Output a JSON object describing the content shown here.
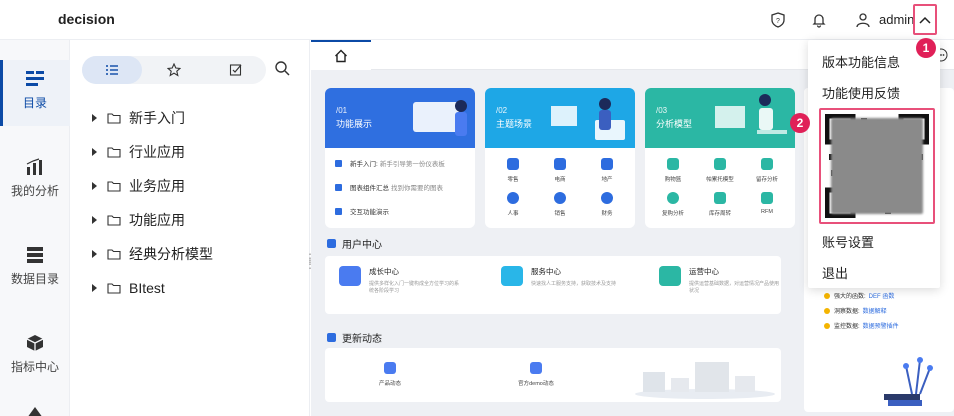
{
  "app": {
    "title": "decision"
  },
  "header": {
    "user": "admin"
  },
  "rail": [
    {
      "label": "目录",
      "active": true
    },
    {
      "label": "我的分析"
    },
    {
      "label": "数据目录"
    },
    {
      "label": "指标中心"
    }
  ],
  "tree": {
    "nodes": [
      "新手入门",
      "行业应用",
      "业务应用",
      "功能应用",
      "经典分析模型",
      "BItest"
    ]
  },
  "banners": [
    {
      "num": "/01",
      "title": "功能展示",
      "color": "#2f6fe0"
    },
    {
      "num": "/02",
      "title": "主题场景",
      "color": "#1ea7e6"
    },
    {
      "num": "/03",
      "title": "分析模型",
      "color": "#2bb7a4"
    }
  ],
  "feature_list": [
    {
      "title": "新手入门:",
      "desc": "新手引导第一份仪表板"
    },
    {
      "title": "图表组件汇总",
      "desc": "找到你需要的图表"
    },
    {
      "title": "交互功能演示",
      "desc": ""
    }
  ],
  "scene_grid": [
    "零售",
    "电商",
    "地产",
    "人事",
    "销售",
    "财务"
  ],
  "model_grid": [
    "购物篮",
    "帕累托模型",
    "留存分析",
    "复购分析",
    "库存周转",
    "RFM"
  ],
  "sections": {
    "user_center": "用户中心",
    "updates": "更新动态"
  },
  "user_center_cards": [
    {
      "title": "成长中心",
      "desc": "提供多样化入门一键构成全方位学习的系统各阶段学习"
    },
    {
      "title": "服务中心",
      "desc": "快速找人工服务支持，获取技术及支持"
    },
    {
      "title": "运营中心",
      "desc": "提供运营基础数据，对运营情况产品使用状况"
    }
  ],
  "update_cards": [
    {
      "title": "产品动态"
    },
    {
      "title": "官方demo动态"
    }
  ],
  "side_lines": [
    {
      "text": "强大的函数:",
      "link": "DEF 函数"
    },
    {
      "text": "洞察数据:",
      "link": "数据解释"
    },
    {
      "text": "监控数据:",
      "link": "数据预警插件"
    }
  ],
  "dropdown": {
    "items": [
      "版本功能信息",
      "功能使用反馈",
      "账号设置",
      "退出"
    ]
  },
  "badges": [
    "1",
    "2"
  ],
  "colors": {
    "accent": "#0b4aa6",
    "highlight": "#e8507a",
    "badge": "#e02058"
  }
}
